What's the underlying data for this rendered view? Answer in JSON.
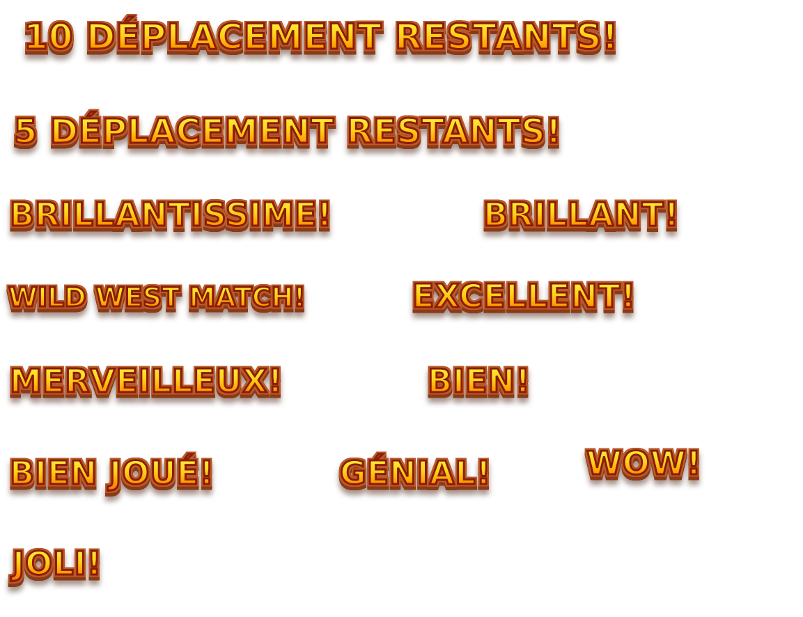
{
  "messages": {
    "moves_10": "10 DÉPLACEMENT RESTANTS!",
    "moves_5": "5 DÉPLACEMENT RESTANTS!",
    "brillantissime": "BRILLANTISSIME!",
    "brillant": "BRILLANT!",
    "wild_west_match": "WILD WEST MATCH!",
    "excellent": "EXCELLENT!",
    "merveilleux": "MERVEILLEUX!",
    "bien": "BIEN!",
    "bien_joue": "BIEN JOUÉ!",
    "genial": "GÉNIAL!",
    "wow": "WOW!",
    "joli": "JOLI!"
  },
  "colors": {
    "fill_top": "#fff43a",
    "fill_bottom": "#ff7a00",
    "outline": "#8a1c08",
    "shadow": "#8c3a16",
    "background": "#ffffff"
  }
}
